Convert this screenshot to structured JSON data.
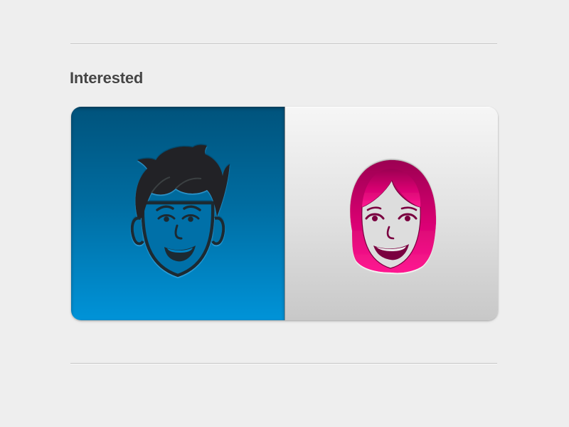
{
  "section": {
    "title": "Interested"
  },
  "toggle": {
    "options": [
      {
        "value": "male",
        "icon": "male-face-icon",
        "selected": true
      },
      {
        "value": "female",
        "icon": "female-face-icon",
        "selected": false
      }
    ]
  },
  "colors": {
    "background": "#eeeeee",
    "selected_blue_top": "#00537c",
    "selected_blue_bottom": "#0093d8",
    "female_accent": "#e8087f",
    "title_text": "#454545"
  }
}
